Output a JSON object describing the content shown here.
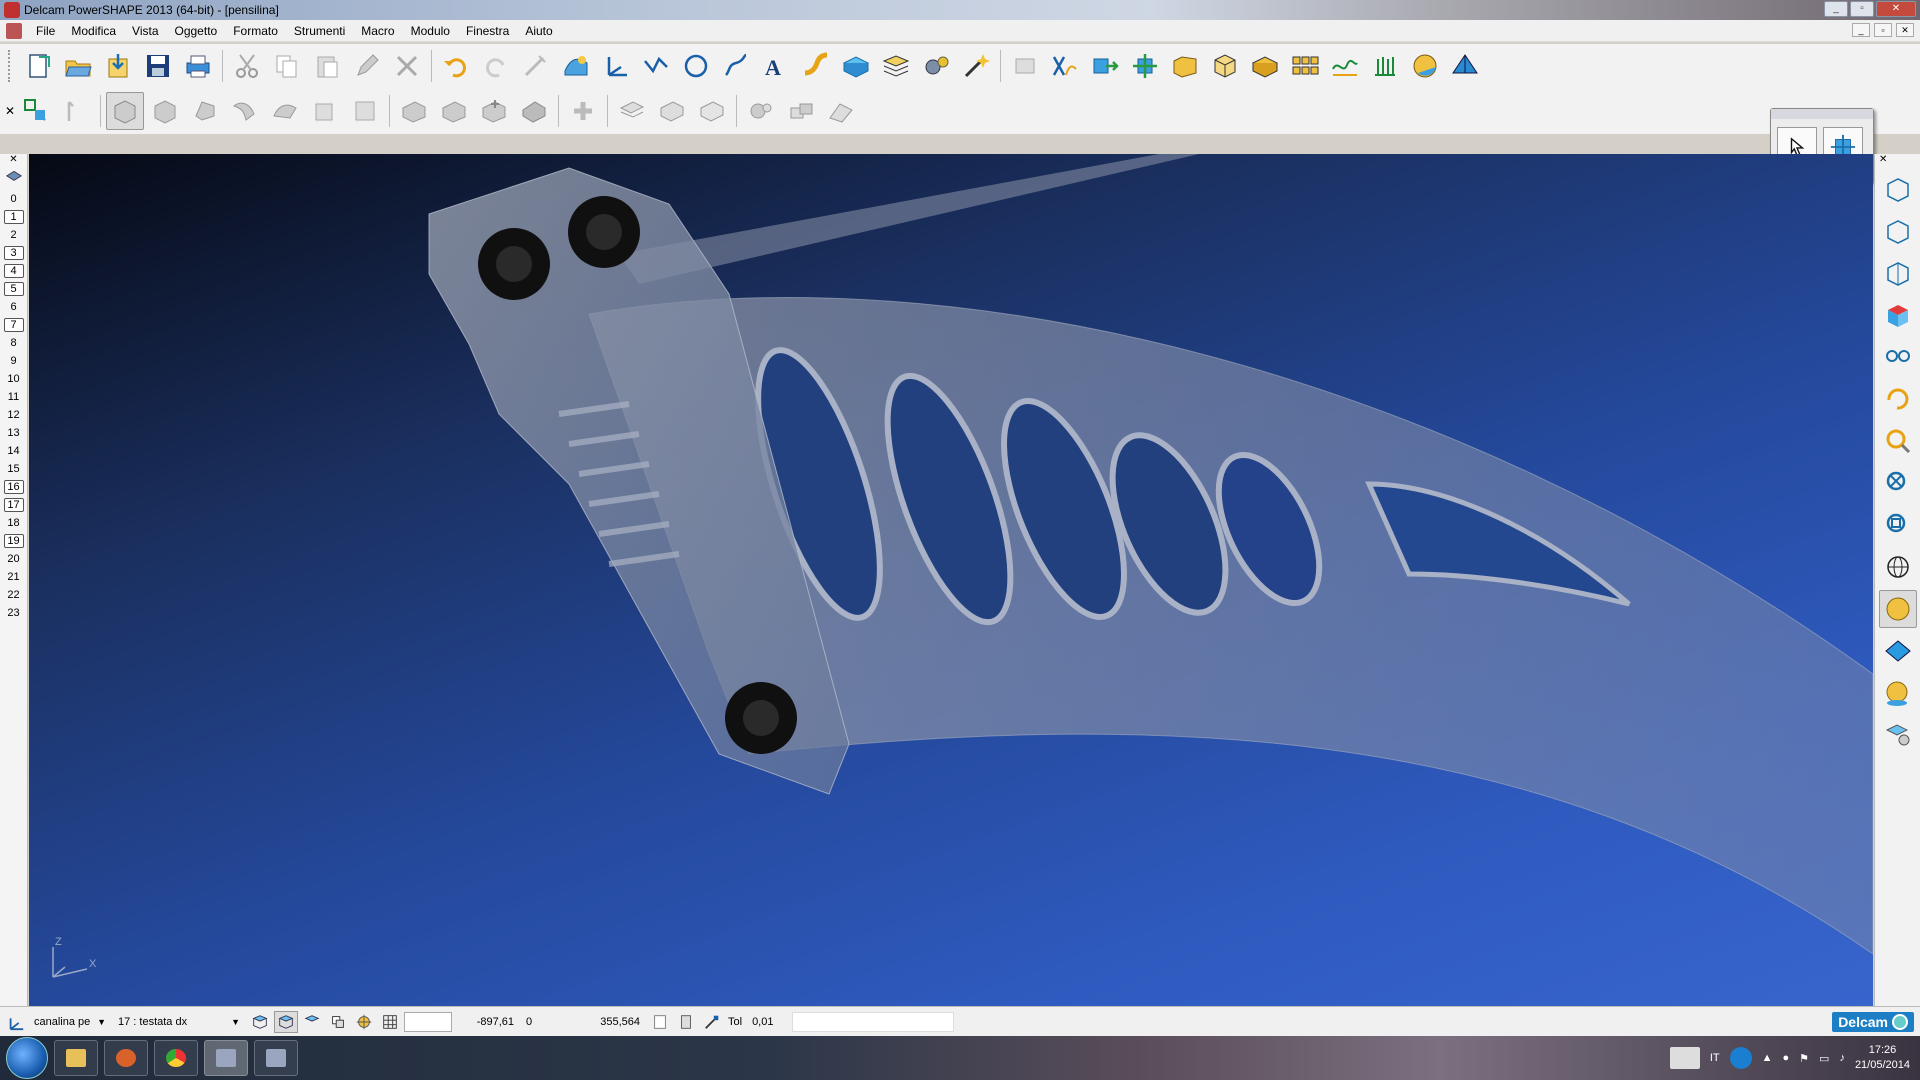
{
  "window": {
    "title": "Delcam PowerSHAPE 2013 (64-bit) - [pensilina]"
  },
  "menu": [
    "File",
    "Modifica",
    "Vista",
    "Oggetto",
    "Formato",
    "Strumenti",
    "Macro",
    "Modulo",
    "Finestra",
    "Aiuto"
  ],
  "toolbar_main": {
    "icons": [
      "new-icon",
      "open-icon",
      "import-icon",
      "save-icon",
      "print-icon",
      "cut-icon",
      "copy-icon",
      "paste-icon",
      "edit-icon",
      "delete-icon",
      "undo-icon",
      "redo-icon",
      "measure-icon",
      "surface-icon",
      "workplane-icon",
      "line-icon",
      "circle-icon",
      "curve-icon",
      "text-icon",
      "composite-curve-icon",
      "primitive-icon",
      "wireframe-icon",
      "tools-icon",
      "wand-icon",
      "mesh-icon",
      "intersection-icon",
      "move-icon",
      "rotate-icon",
      "solid-icon",
      "box-icon",
      "feature-icon",
      "array-icon",
      "graph-icon",
      "spike-icon",
      "sphere-icon",
      "plane-icon"
    ]
  },
  "toolbar_solid": {
    "icons": [
      "selection-icon",
      "select-solid-icon",
      "solid-box-icon",
      "solid-extrude-icon",
      "solid-revolve-icon",
      "solid-sweep-icon",
      "solid-shell-icon",
      "solid-cut-icon",
      "solid-boolean-add-icon",
      "solid-boolean-sub-icon",
      "solid-boolean-int-icon",
      "solid-fillet-icon",
      "solid-feature-icon",
      "solid-layer-icon",
      "solid-face-icon",
      "solid-block-icon",
      "solid-gear-icon",
      "solid-assembly-icon",
      "solid-history-icon"
    ]
  },
  "levels": [
    "0",
    "1",
    "2",
    "3",
    "4",
    "5",
    "6",
    "7",
    "8",
    "9",
    "10",
    "11",
    "12",
    "13",
    "14",
    "15",
    "16",
    "17",
    "18",
    "19",
    "20",
    "21",
    "22",
    "23"
  ],
  "levels_boxed": [
    "1",
    "3",
    "4",
    "5",
    "7",
    "16",
    "17",
    "19"
  ],
  "viewport": {
    "triad_z": "Z",
    "triad_x": "X"
  },
  "right_tools": [
    "view-iso-icon",
    "view-iso2-icon",
    "view-iso3-icon",
    "view-cube-icon",
    "view-glasses-icon",
    "rotate-view-icon",
    "zoom-icon",
    "zoom-fit-icon",
    "zoom-box-icon",
    "globe-icon",
    "shaded-icon",
    "plane-view-icon",
    "render-icon",
    "material-icon"
  ],
  "status": {
    "workplane": "canalina pe",
    "level": "17 : testata dx",
    "x": "-897,61",
    "y": "0",
    "z": "355,564",
    "tol_label": "Tol",
    "tol_value": "0,01",
    "brand": "Delcam"
  },
  "taskbar": {
    "lang": "IT",
    "time": "17:26",
    "date": "21/05/2014"
  }
}
